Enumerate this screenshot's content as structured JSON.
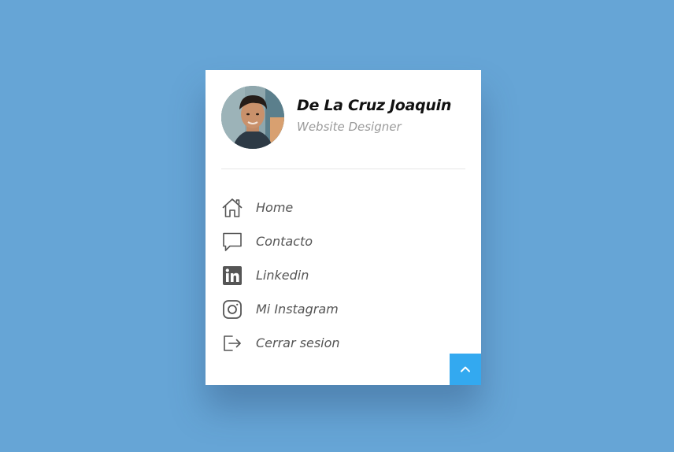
{
  "profile": {
    "name": "De La Cruz Joaquin",
    "role": "Website Designer"
  },
  "menu": {
    "items": [
      {
        "label": "Home",
        "icon": "home-icon"
      },
      {
        "label": "Contacto",
        "icon": "chat-icon"
      },
      {
        "label": "Linkedin",
        "icon": "linkedin-icon"
      },
      {
        "label": "Mi Instagram",
        "icon": "instagram-icon"
      },
      {
        "label": "Cerrar sesion",
        "icon": "logout-icon"
      }
    ]
  },
  "scroll_top": {
    "icon": "chevron-up-icon"
  },
  "colors": {
    "background": "#66a5d6",
    "card": "#ffffff",
    "accent": "#33a9f0",
    "text_primary": "#111111",
    "text_secondary": "#9a9a9a",
    "menu_text": "#555555"
  }
}
